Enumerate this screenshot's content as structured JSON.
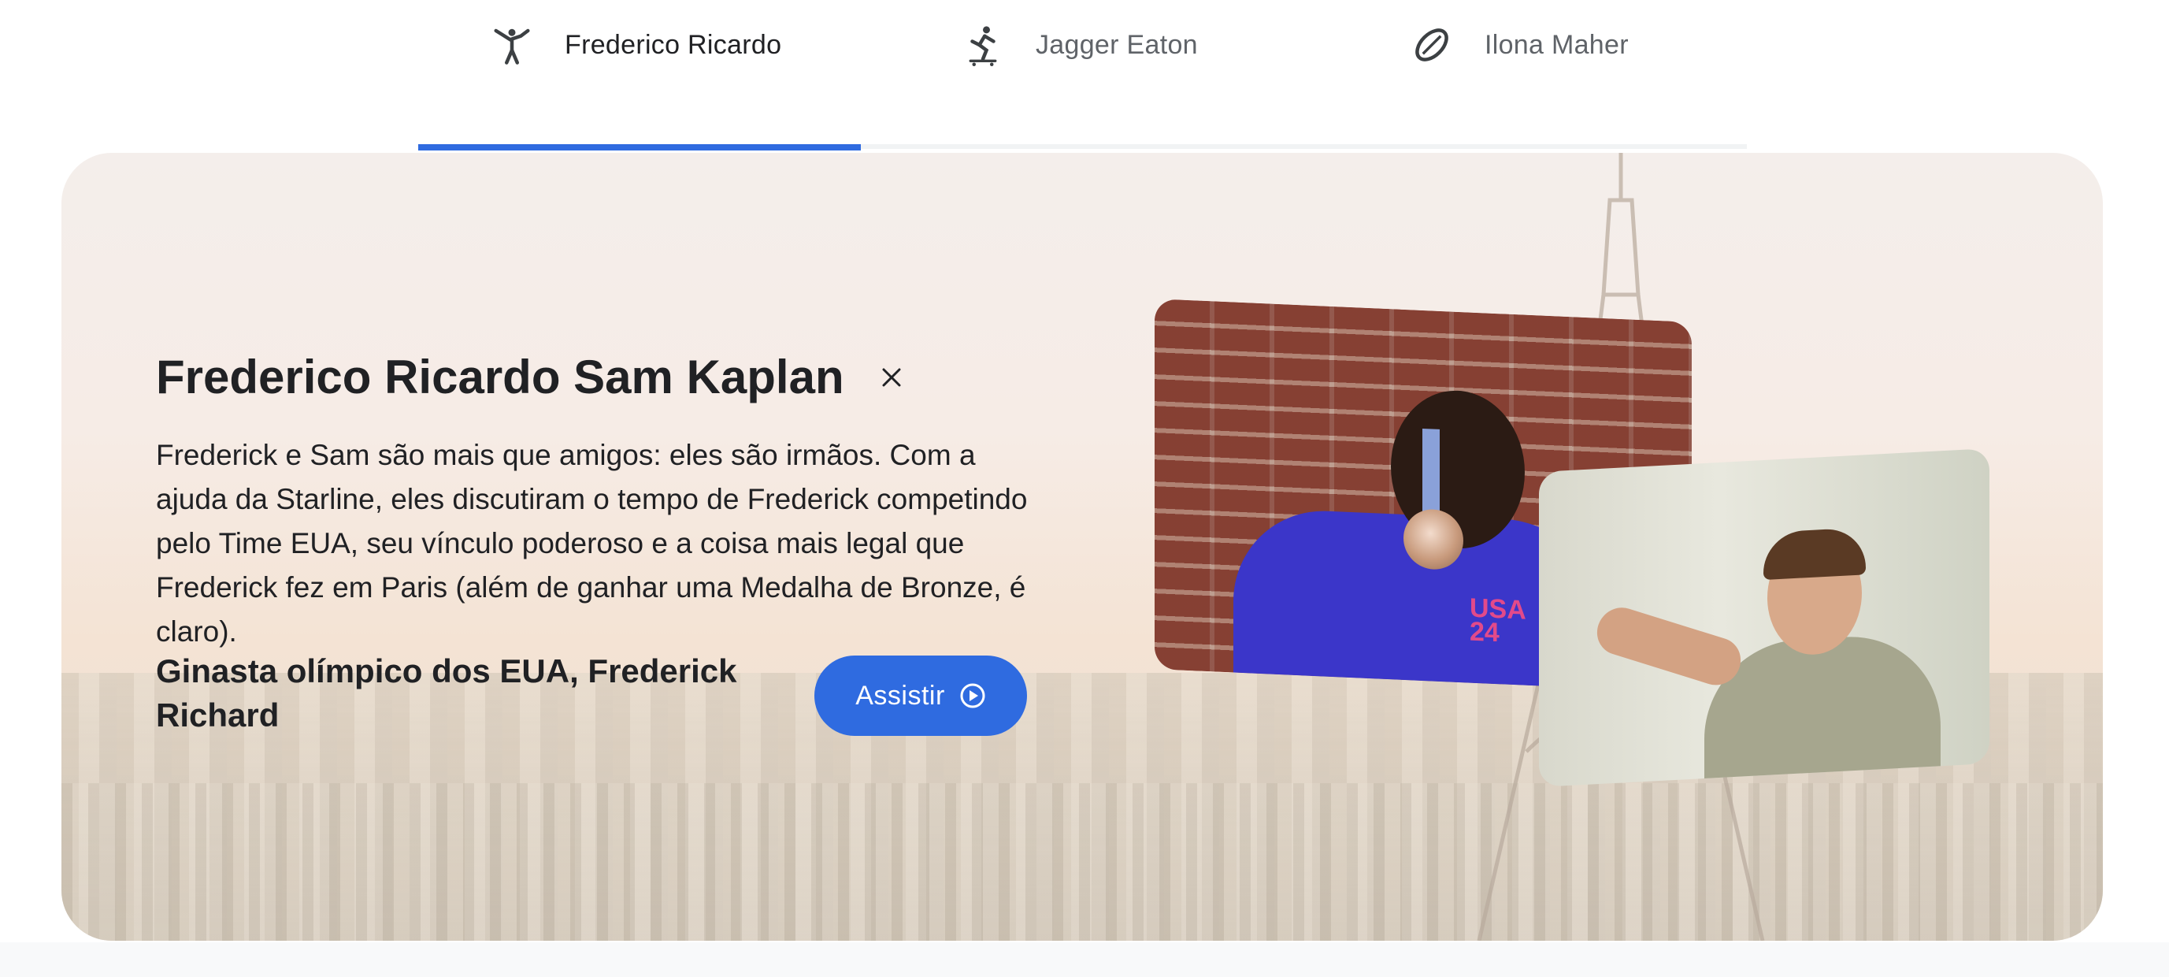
{
  "tabs": [
    {
      "label": "Frederico Ricardo",
      "icon": "gymnastics-icon",
      "active": true
    },
    {
      "label": "Jagger Eaton",
      "icon": "skateboarding-icon",
      "active": false
    },
    {
      "label": "Ilona Maher",
      "icon": "rugby-ball-icon",
      "active": false
    }
  ],
  "feature": {
    "title": "Frederico Ricardo Sam Kaplan",
    "description": "Frederick e Sam são mais que amigos: eles são irmãos. Com a ajuda da Starline, eles discutiram o tempo de Frederick competindo pelo Time EUA, seu vínculo poderoso e a coisa mais legal que Frederick fez em Paris (além de ganhar uma Medalha de Bronze, é claro).",
    "caption": "Ginasta olímpico dos EUA, Frederick Richard",
    "watch_label": "Assistir",
    "photo1_text": "USA\n24"
  },
  "colors": {
    "accent": "#2f6be0",
    "text": "#202124",
    "muted_text": "#5f6368"
  }
}
